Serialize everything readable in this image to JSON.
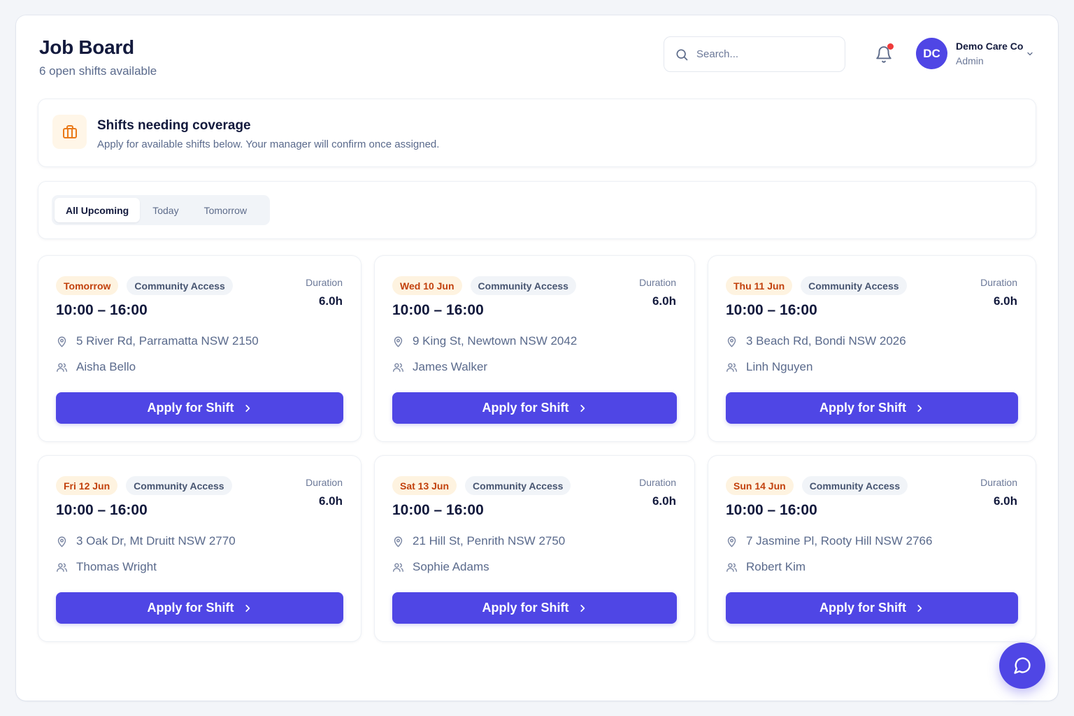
{
  "header": {
    "title": "Job Board",
    "subtitle": "6 open shifts available"
  },
  "search": {
    "placeholder": "Search...",
    "value": ""
  },
  "notifications": {
    "has_unread": true,
    "dot_color": "#ef3b3b"
  },
  "user": {
    "initials": "DC",
    "name": "Demo Care Co",
    "role": "Admin"
  },
  "banner": {
    "icon": "briefcase-icon",
    "title": "Shifts needing coverage",
    "text": "Apply for available shifts below. Your manager will confirm once assigned."
  },
  "filters": {
    "tabs": [
      {
        "label": "All Upcoming",
        "active": true
      },
      {
        "label": "Today",
        "active": false
      },
      {
        "label": "Tomorrow",
        "active": false
      }
    ]
  },
  "shifts": [
    {
      "date": "Tomorrow",
      "type": "Community Access",
      "time": "10:00 – 16:00",
      "duration_label": "Duration",
      "duration": "6.0h",
      "address": "5 River Rd, Parramatta NSW 2150",
      "client": "Aisha Bello",
      "action": "Apply for Shift"
    },
    {
      "date": "Wed 10 Jun",
      "type": "Community Access",
      "time": "10:00 – 16:00",
      "duration_label": "Duration",
      "duration": "6.0h",
      "address": "9 King St, Newtown NSW 2042",
      "client": "James Walker",
      "action": "Apply for Shift"
    },
    {
      "date": "Thu 11 Jun",
      "type": "Community Access",
      "time": "10:00 – 16:00",
      "duration_label": "Duration",
      "duration": "6.0h",
      "address": "3 Beach Rd, Bondi NSW 2026",
      "client": "Linh Nguyen",
      "action": "Apply for Shift"
    },
    {
      "date": "Fri 12 Jun",
      "type": "Community Access",
      "time": "10:00 – 16:00",
      "duration_label": "Duration",
      "duration": "6.0h",
      "address": "3 Oak Dr, Mt Druitt NSW 2770",
      "client": "Thomas Wright",
      "action": "Apply for Shift"
    },
    {
      "date": "Sat 13 Jun",
      "type": "Community Access",
      "time": "10:00 – 16:00",
      "duration_label": "Duration",
      "duration": "6.0h",
      "address": "21 Hill St, Penrith NSW 2750",
      "client": "Sophie Adams",
      "action": "Apply for Shift"
    },
    {
      "date": "Sun 14 Jun",
      "type": "Community Access",
      "time": "10:00 – 16:00",
      "duration_label": "Duration",
      "duration": "6.0h",
      "address": "7 Jasmine Pl, Rooty Hill NSW 2766",
      "client": "Robert Kim",
      "action": "Apply for Shift"
    }
  ],
  "colors": {
    "accent": "#4f46e5",
    "date_badge_bg": "#fef3e0",
    "date_badge_text": "#c2410c",
    "banner_icon": "#ea7a1a"
  },
  "fab": {
    "icon": "chat-bubble-icon"
  }
}
